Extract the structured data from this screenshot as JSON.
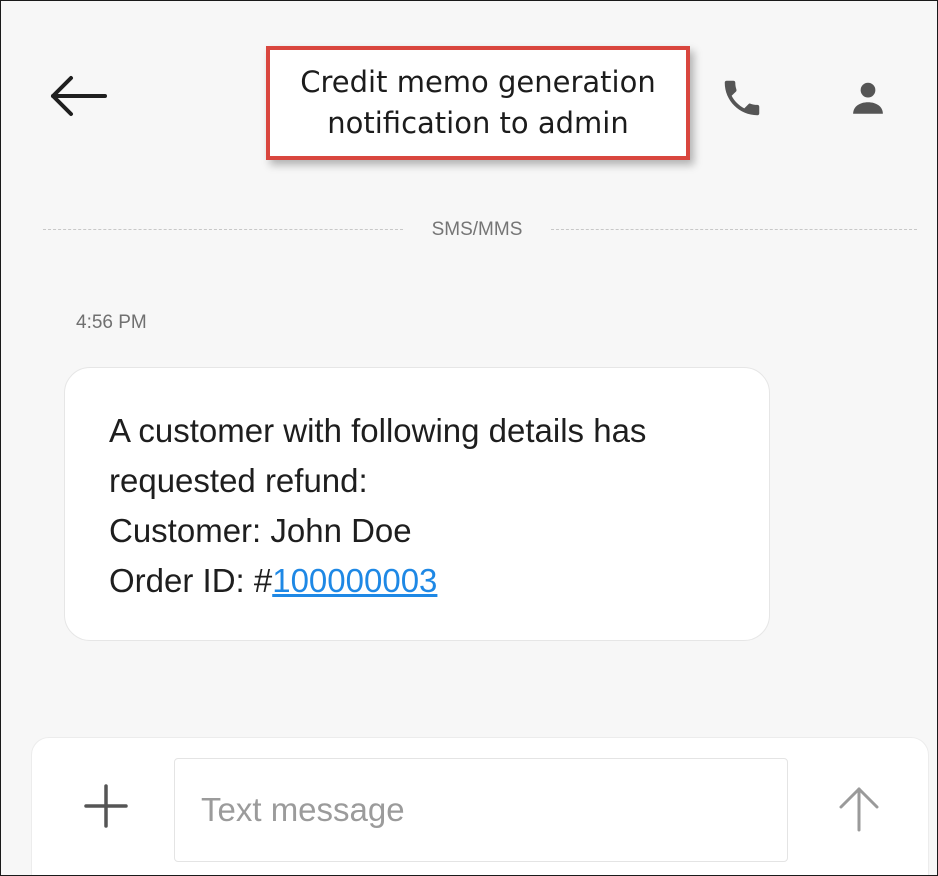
{
  "header": {
    "back_icon": "arrow-left-icon",
    "call_icon": "phone-icon",
    "contact_icon": "person-icon"
  },
  "annotation": {
    "line1": "Credit memo generation",
    "line2": "notification to admin",
    "border_color": "#d9463e"
  },
  "conversation": {
    "channel_label": "SMS/MMS",
    "messages": [
      {
        "time": "4:56 PM",
        "line1": "A customer with following details has",
        "line2": "requested refund:",
        "line3": "Customer: John Doe",
        "order_prefix": "Order ID: #",
        "order_id": "100000003"
      }
    ]
  },
  "compose": {
    "add_icon": "plus-icon",
    "placeholder": "Text message",
    "send_icon": "arrow-up-icon"
  },
  "colors": {
    "link": "#1e88e5",
    "icon": "#555555"
  }
}
